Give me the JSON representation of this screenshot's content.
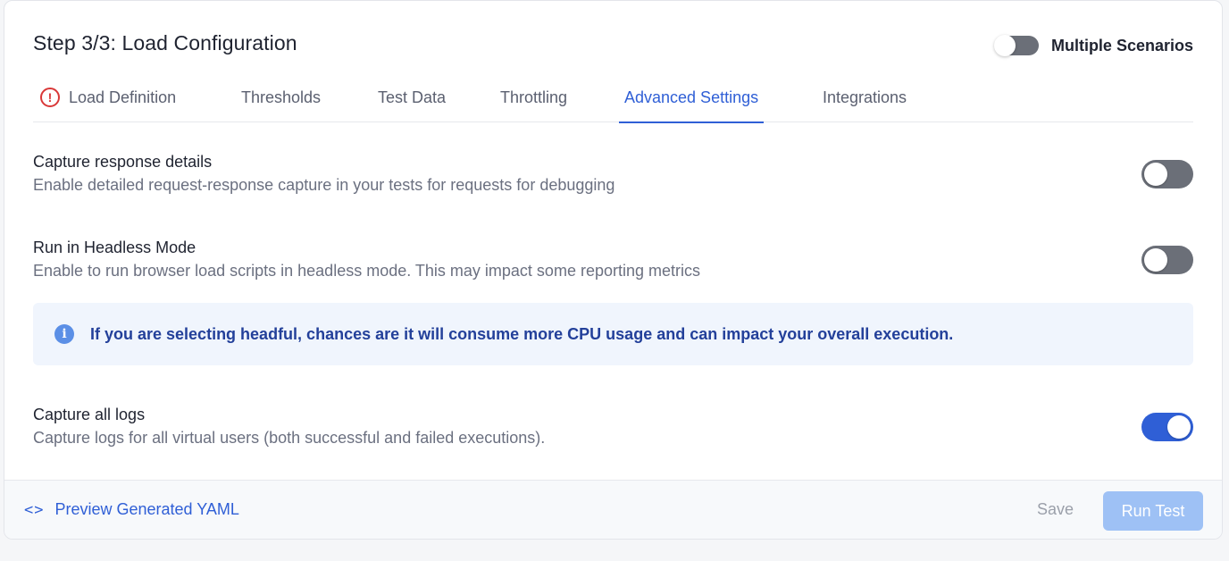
{
  "header": {
    "title": "Step 3/3: Load Configuration",
    "multiple_scenarios_label": "Multiple Scenarios",
    "multiple_scenarios_enabled": false
  },
  "tabs": [
    {
      "label": "Load Definition",
      "icon": "error-icon",
      "active": false
    },
    {
      "label": "Thresholds",
      "active": false
    },
    {
      "label": "Test Data",
      "active": false
    },
    {
      "label": "Throttling",
      "active": false
    },
    {
      "label": "Advanced Settings",
      "active": true
    },
    {
      "label": "Integrations",
      "active": false
    }
  ],
  "settings": [
    {
      "title": "Capture response details",
      "description": "Enable detailed request-response capture in your tests for requests for debugging",
      "enabled": false
    },
    {
      "title": "Run in Headless Mode",
      "description": "Enable to run browser load scripts in headless mode. This may impact some reporting metrics",
      "enabled": false
    },
    {
      "title": "Capture all logs",
      "description": "Capture logs for all virtual users (both successful and failed executions).",
      "enabled": true
    }
  ],
  "info": {
    "icon": "info-icon",
    "text": "If you are selecting headful, chances are it will consume more CPU usage and can impact your overall execution."
  },
  "footer": {
    "preview_icon": "code-icon",
    "preview_label": "Preview Generated YAML",
    "save_label": "Save",
    "run_label": "Run Test"
  },
  "colors": {
    "accent": "#2f5fd6",
    "error": "#d93838",
    "toggle_off": "#6b6f78",
    "run_button_disabled": "#9ec1f5"
  }
}
